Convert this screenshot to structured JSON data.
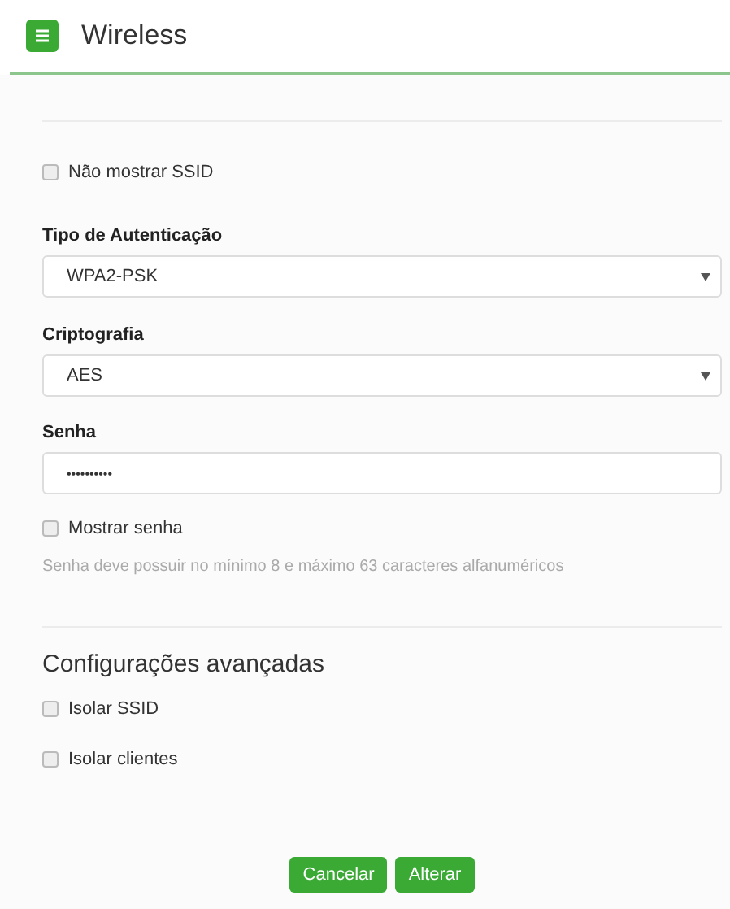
{
  "header": {
    "title": "Wireless"
  },
  "hide_ssid": {
    "label": "Não mostrar SSID",
    "checked": false
  },
  "fields": [
    {
      "kind": "select",
      "label": "Tipo de Autenticação",
      "value": "WPA2-PSK"
    },
    {
      "kind": "select",
      "label": "Criptografia",
      "value": "AES"
    },
    {
      "kind": "password",
      "label": "Senha",
      "value": "••••••••••"
    }
  ],
  "show_password": {
    "label": "Mostrar senha",
    "checked": false
  },
  "hint": "Senha deve possuir no mínimo 8 e máximo 63 caracteres alfanuméricos",
  "advanced": {
    "title": "Configurações avançadas",
    "options": [
      {
        "label": "Isolar SSID",
        "checked": false
      },
      {
        "label": "Isolar clientes",
        "checked": false
      }
    ]
  },
  "buttons": [
    "Cancelar",
    "Alterar"
  ]
}
